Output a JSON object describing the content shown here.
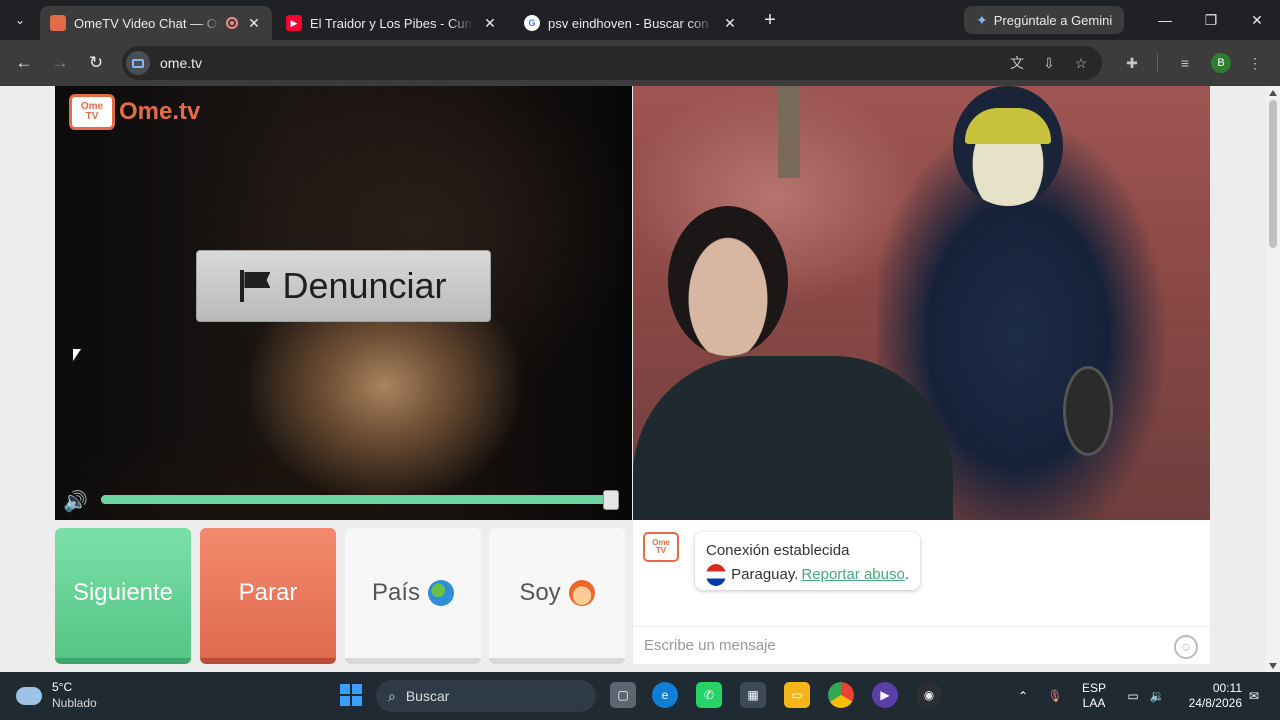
{
  "browser": {
    "tabs": [
      {
        "title": "OmeTV Video Chat — Ome",
        "favicon_color": "#e46b47",
        "active": true,
        "recording": true
      },
      {
        "title": "El Traidor y Los Pibes - Cumbia",
        "favicon_color": "#ff0033",
        "active": false
      },
      {
        "title": "psv eindhoven - Buscar con Go",
        "favicon_color": "#4285f4",
        "active": false
      }
    ],
    "gemini_label": "Pregúntale a Gemini",
    "url": "ome.tv",
    "profile_initial": "B"
  },
  "page": {
    "logo_badge_top": "Ome",
    "logo_badge_bottom": "TV",
    "logo_text": "Ome.tv",
    "report_button": "Denunciar",
    "volume_level": 0.98,
    "buttons": {
      "next": "Siguiente",
      "stop": "Parar",
      "country": "País",
      "gender": "Soy"
    },
    "chat": {
      "logo_top": "Ome",
      "logo_bottom": "TV",
      "status": "Conexión establecida",
      "country": "Paraguay.",
      "report_link": "Reportar abuso",
      "report_suffix": ".",
      "input_placeholder": "Escribe un mensaje"
    }
  },
  "taskbar": {
    "weather_temp": "5°C",
    "weather_condition": "Nublado",
    "search_label": "Buscar",
    "language_top": "ESP",
    "language_bottom": "LAA",
    "time": "00:11",
    "date": "24/8/2026"
  },
  "colors": {
    "accent": "#e46b47",
    "next_green": "#56c585",
    "stop_red": "#e06a4f",
    "volume_fill": "#6dd3a0"
  }
}
